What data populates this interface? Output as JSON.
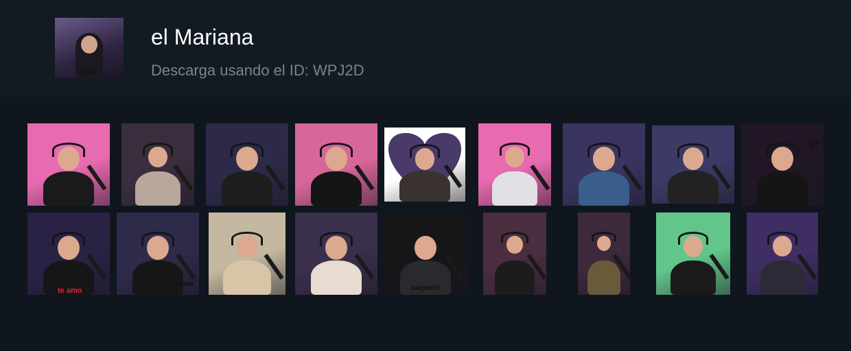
{
  "profile": {
    "name": "el Mariana",
    "subtitle": "Descarga usando el ID: WPJ2D",
    "avatar_caption": "puto"
  },
  "emotes": [
    {
      "id": "e1",
      "caption": "",
      "bg": "#e86ab0",
      "shirt": "#1a1a1a"
    },
    {
      "id": "e2",
      "caption": "",
      "bg": "#3a2e3e",
      "shirt": "#b8a79a"
    },
    {
      "id": "e3",
      "caption": "",
      "bg": "#2c2a48",
      "shirt": "#1d1d1d"
    },
    {
      "id": "e4",
      "caption": "",
      "bg": "#d7679a",
      "shirt": "#151515"
    },
    {
      "id": "e5",
      "caption": "",
      "bg": "#ffffff",
      "shirt": "#3a3230"
    },
    {
      "id": "e6",
      "caption": "",
      "bg": "#e86ab0",
      "shirt": "#e0e0e6"
    },
    {
      "id": "e7",
      "caption": "",
      "bg": "#3a3560",
      "shirt": "#3a5e8c"
    },
    {
      "id": "e8",
      "caption": "",
      "bg": "#3c3a66",
      "shirt": "#222"
    },
    {
      "id": "e9",
      "caption": "Q?",
      "bg": "#201626",
      "shirt": "#151515"
    },
    {
      "id": "e10",
      "caption": "te amo",
      "bg": "#2a2244",
      "shirt": "#161616"
    },
    {
      "id": "e11",
      "caption": "wuaw",
      "bg": "#2e2a4a",
      "shirt": "#161616"
    },
    {
      "id": "e12",
      "caption": "",
      "bg": "#c4b8a0",
      "shirt": "#d8c4a6"
    },
    {
      "id": "e13",
      "caption": "",
      "bg": "#3a2f4c",
      "shirt": "#e8dcd0"
    },
    {
      "id": "e14",
      "caption": "vaquero",
      "bg": "#161618",
      "shirt": "#2a2a2e"
    },
    {
      "id": "e15",
      "caption": "",
      "bg": "#4a2e40",
      "shirt": "#1c1c1c"
    },
    {
      "id": "e16",
      "caption": "",
      "bg": "#3c2a3c",
      "shirt": "#6a5a3c"
    },
    {
      "id": "e17",
      "caption": "",
      "bg": "#62c68a",
      "shirt": "#1a1a1a"
    },
    {
      "id": "e18",
      "caption": "",
      "bg": "#3e2e64",
      "shirt": "#2c2a36"
    }
  ]
}
